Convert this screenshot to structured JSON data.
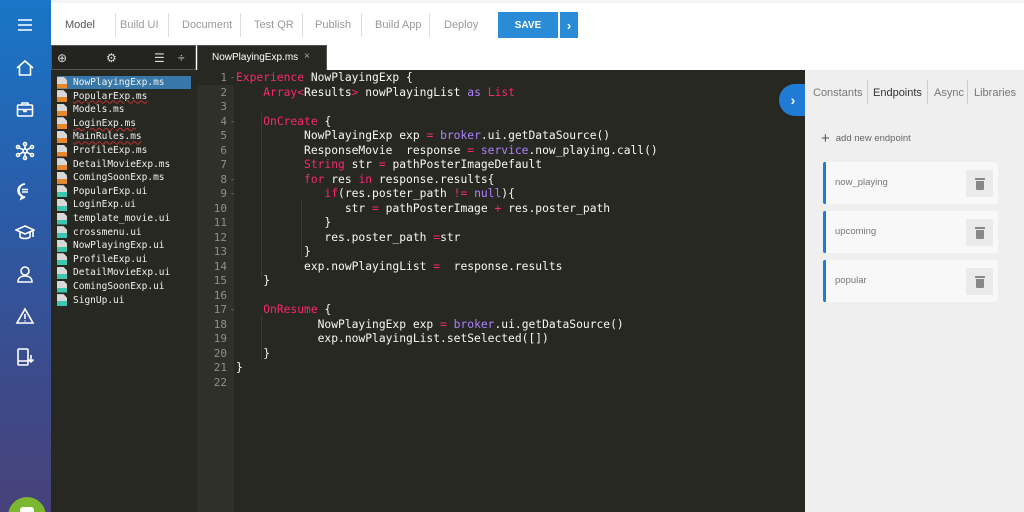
{
  "topbar": {
    "tabs": [
      {
        "label": "Model",
        "active": true
      },
      {
        "label": "Build UI"
      },
      {
        "label": "Document"
      },
      {
        "label": "Test QR"
      },
      {
        "label": "Publish"
      },
      {
        "label": "Build App"
      },
      {
        "label": "Deploy"
      }
    ],
    "save_label": "SAVE",
    "save_more_label": "›"
  },
  "leftnav": {
    "items": [
      "menu-icon",
      "home-icon",
      "briefcase-icon",
      "network-icon",
      "chat-icon",
      "graduation-cap-icon",
      "user-icon",
      "warning-icon",
      "mobile-download-icon"
    ]
  },
  "filetoolbar": {
    "add": "⊕",
    "settings": "⚙",
    "list": "☰",
    "split": "÷"
  },
  "files": [
    {
      "name": "NowPlayingExp.ms",
      "type": "ms",
      "selected": true
    },
    {
      "name": "PopularExp.ms",
      "type": "ms",
      "error": true
    },
    {
      "name": "Models.ms",
      "type": "ms"
    },
    {
      "name": "LoginExp.ms",
      "type": "ms",
      "error": true
    },
    {
      "name": "MainRules.ms",
      "type": "ms",
      "error": true
    },
    {
      "name": "ProfileExp.ms",
      "type": "ms"
    },
    {
      "name": "DetailMovieExp.ms",
      "type": "ms"
    },
    {
      "name": "ComingSoonExp.ms",
      "type": "ms"
    },
    {
      "name": "PopularExp.ui",
      "type": "ui"
    },
    {
      "name": "LoginExp.ui",
      "type": "ui"
    },
    {
      "name": "template_movie.ui",
      "type": "ui"
    },
    {
      "name": "crossmenu.ui",
      "type": "ui"
    },
    {
      "name": "NowPlayingExp.ui",
      "type": "ui"
    },
    {
      "name": "ProfileExp.ui",
      "type": "ui"
    },
    {
      "name": "DetailMovieExp.ui",
      "type": "ui"
    },
    {
      "name": "ComingSoonExp.ui",
      "type": "ui"
    },
    {
      "name": "SignUp.ui",
      "type": "ui"
    }
  ],
  "editor": {
    "tab_label": "NowPlayingExp.ms",
    "tab_close": "×",
    "lines": [
      "<k>Experience</k> NowPlayingExp {",
      "    <k>Array</k><k><</k>Results<k>></k> nowPlayingList <p>as</p> <k>List</k>",
      "",
      "    <k>OnCreate</k> {",
      "          NowPlayingExp exp <k>=</k> <p>broker</p>.ui.getDataSource()",
      "          ResponseMovie  response <k>=</k> <p>service</p>.now_playing.call()",
      "          <k>String</k> str <k>=</k> pathPosterImageDefault",
      "          <k>for</k> res <k>in</k> response.results{",
      "             <k>if</k>(res.poster_path <k>!=</k> <p>null</p>){",
      "                str <k>=</k> pathPosterImage <k>+</k> res.poster_path",
      "             }",
      "             res.poster_path <k>=</k>str",
      "          }",
      "          exp.nowPlayingList <k>=</k>  response.results",
      "    }",
      "",
      "    <k>OnResume</k> {",
      "            NowPlayingExp exp <k>=</k> <p>broker</p>.ui.getDataSource()",
      "            exp.nowPlayingList.setSelected([])",
      "    }",
      "}",
      ""
    ],
    "fold_lines": [
      1,
      4,
      8,
      9,
      17
    ]
  },
  "rightpanel": {
    "tabs": [
      {
        "label": "Constants"
      },
      {
        "label": "Endpoints",
        "active": true
      },
      {
        "label": "Async"
      },
      {
        "label": "Libraries"
      }
    ],
    "add_label": "add new endpoint",
    "endpoints": [
      "now_playing",
      "upcoming",
      "popular"
    ],
    "collapse_label": "›"
  },
  "colors": {
    "accent": "#2a8bd6",
    "editor_bg": "#272822",
    "keyword": "#f92672",
    "purple": "#ae81ff"
  }
}
